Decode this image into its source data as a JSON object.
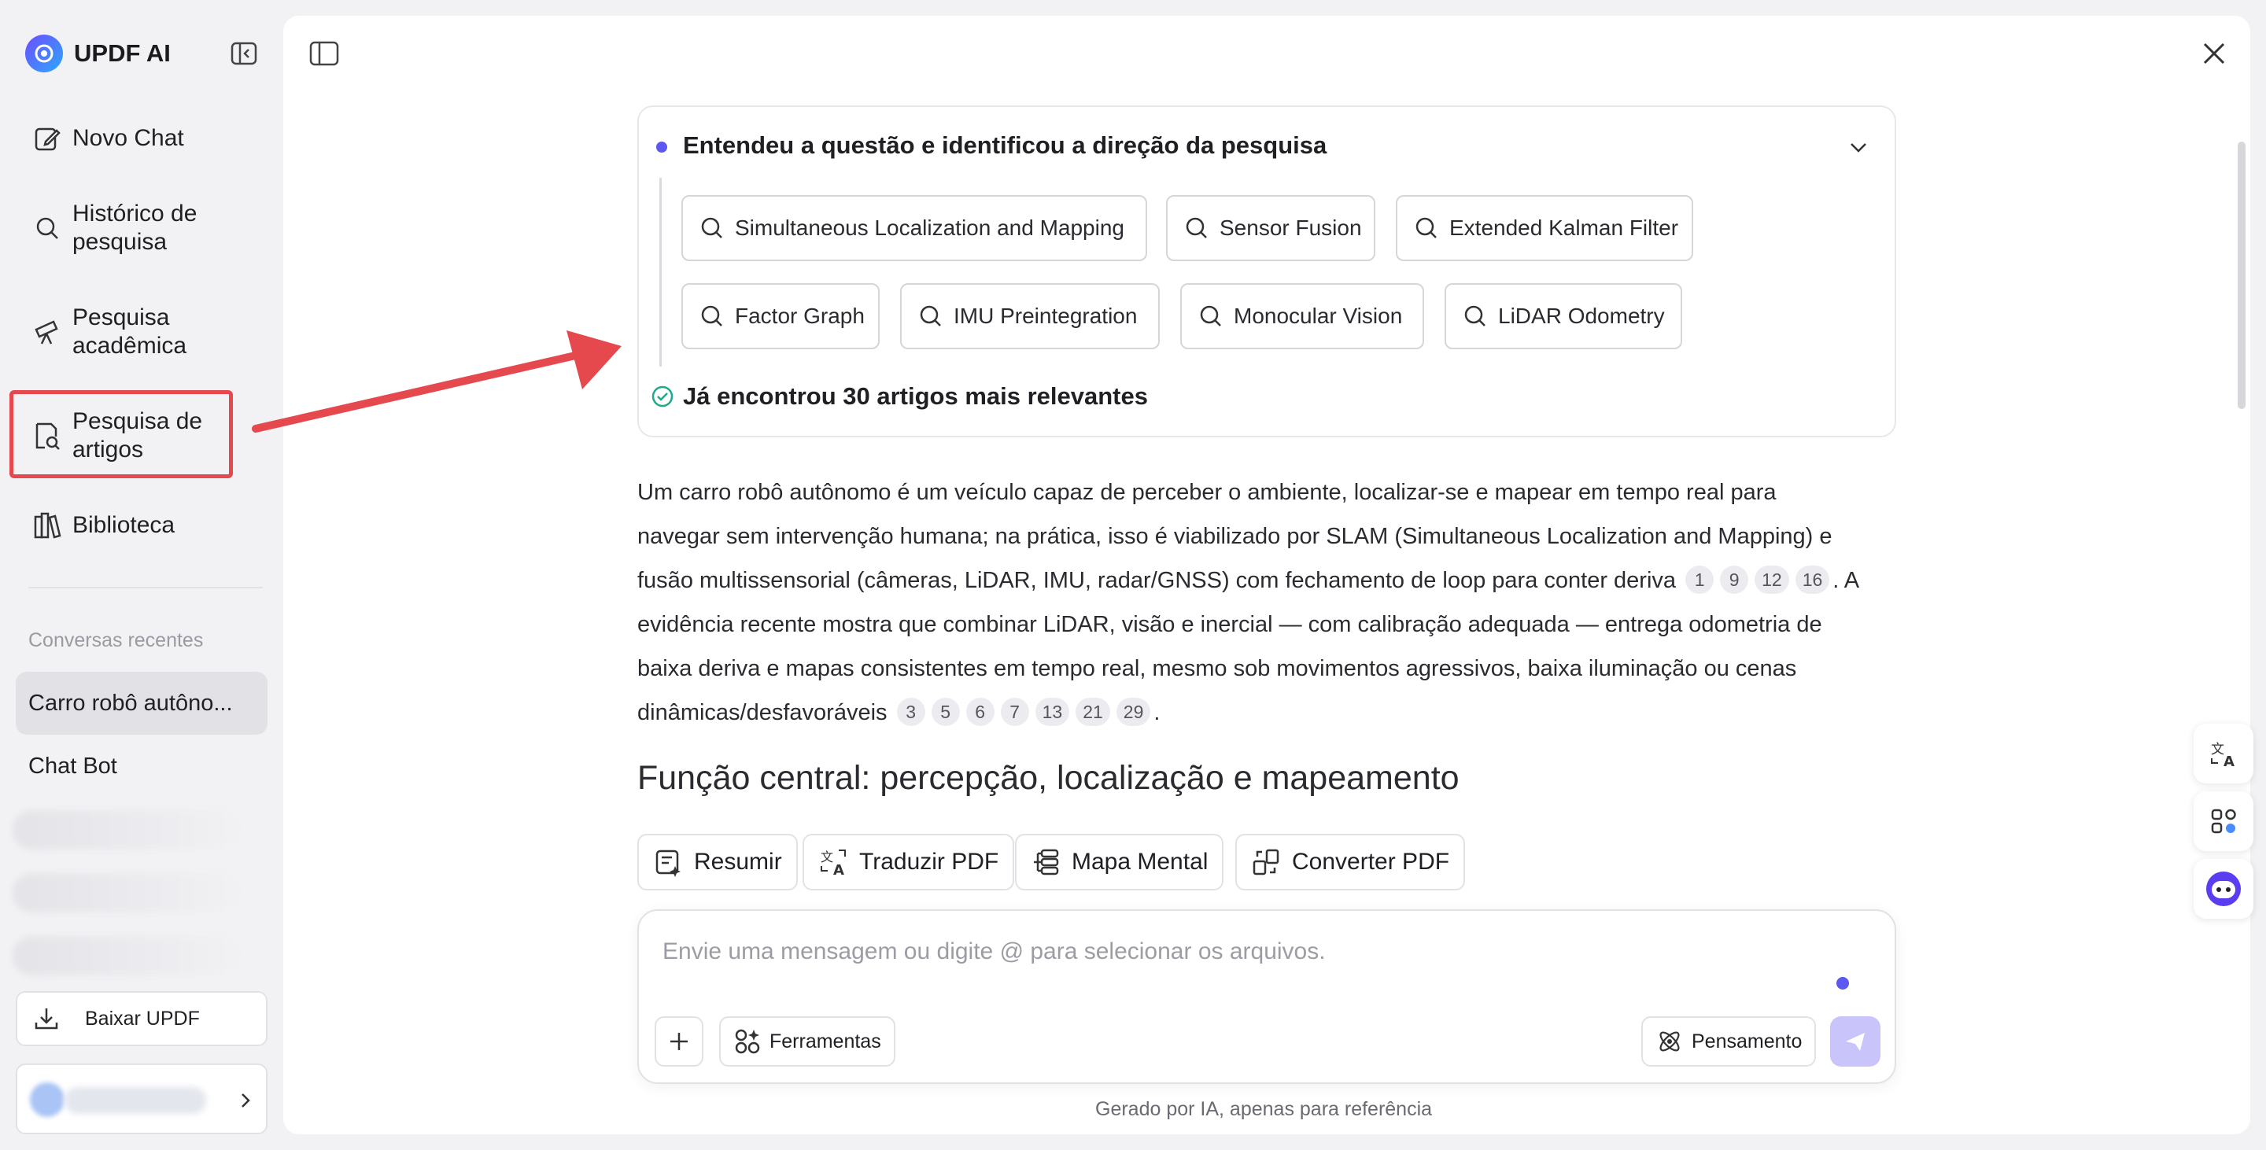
{
  "app": {
    "brand": "UPDF AI"
  },
  "sidebar": {
    "items": [
      {
        "id": "new-chat",
        "label": "Novo Chat"
      },
      {
        "id": "history",
        "label": "Histórico de pesquisa"
      },
      {
        "id": "academic",
        "label": "Pesquisa acadêmica"
      },
      {
        "id": "articles",
        "label": "Pesquisa de artigos"
      },
      {
        "id": "library",
        "label": "Biblioteca"
      }
    ],
    "recent_title": "Conversas recentes",
    "recent": [
      {
        "label": "Carro robô autôno...",
        "active": true
      },
      {
        "label": "Chat Bot",
        "active": false
      }
    ],
    "download_label": "Baixar UPDF"
  },
  "research": {
    "title": "Entendeu a questão e identificou a direção da pesquisa",
    "chips": [
      "Simultaneous Localization and Mapping",
      "Sensor Fusion",
      "Extended Kalman Filter",
      "Factor Graph",
      "IMU Preintegration",
      "Monocular Vision",
      "LiDAR Odometry"
    ],
    "found": "Já encontrou 30 artigos mais relevantes"
  },
  "answer": {
    "p1_l1": "Um carro robô autônomo é um veículo capaz de perceber o ambiente, localizar-se e mapear em tempo real para",
    "p1_l2": "navegar sem intervenção humana; na prática, isso é viabilizado por SLAM (Simultaneous Localization and Mapping) e",
    "p1_l3": "fusão multissensorial (câmeras, LiDAR, IMU, radar/GNSS) com fechamento de loop para conter deriva",
    "refs1": [
      "1",
      "9",
      "12",
      "16"
    ],
    "p1_l3_end": ". A",
    "p1_l4": "evidência recente mostra que combinar LiDAR, visão e inercial — com calibração adequada — entrega odometria de",
    "p1_l5": "baixa deriva e mapas consistentes em tempo real, mesmo sob movimentos agressivos, baixa iluminação ou cenas",
    "p1_l6": "dinâmicas/desfavoráveis",
    "refs2": [
      "3",
      "5",
      "6",
      "7",
      "13",
      "21",
      "29"
    ],
    "p1_l6_end": ".",
    "heading": "Função central: percepção, localização e mapeamento"
  },
  "tools": [
    {
      "id": "summarize",
      "label": "Resumir"
    },
    {
      "id": "translate",
      "label": "Traduzir PDF"
    },
    {
      "id": "mindmap",
      "label": "Mapa Mental"
    },
    {
      "id": "convert",
      "label": "Converter PDF"
    }
  ],
  "composer": {
    "placeholder": "Envie uma mensagem ou digite @ para selecionar os arquivos.",
    "tools_label": "Ferramentas",
    "thinking_label": "Pensamento"
  },
  "footnote": "Gerado por IA, apenas para referência",
  "colors": {
    "accent": "#5b57f0",
    "highlight": "#e5484d",
    "send": "#c9c4fa"
  }
}
